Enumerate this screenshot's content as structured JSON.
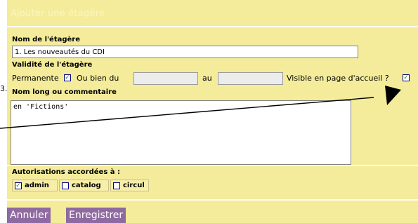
{
  "form": {
    "title": "Ajouter une étagère",
    "name_label": "Nom de l'étagère",
    "name_value": "1. Les nouveautés du CDI",
    "validity_label": "Validité de l'étagère",
    "permanent_label": "Permanente",
    "permanent_checked": true,
    "between_label": "Ou bien du",
    "from_value": "",
    "to_label": "au",
    "to_value": "",
    "visible_label": "Visible en page d'accueil ?",
    "visible_checked": true,
    "comment_label": "Nom long ou commentaire",
    "comment_value": "en 'Fictions'",
    "permissions_label": "Autorisations accordées à :",
    "permissions": [
      {
        "label": "admin",
        "checked": true
      },
      {
        "label": "catalog",
        "checked": false
      },
      {
        "label": "circul",
        "checked": false
      }
    ]
  },
  "buttons": {
    "cancel_label": "Annuler",
    "save_label": "Enregistrer"
  },
  "edge_text": "3.",
  "colors": {
    "panel": "#f4ec9a",
    "button": "#8e6aa0",
    "checkmark": "#2a7a2a"
  },
  "annotation": {
    "type": "arrow",
    "direction": "points to visible-on-homepage checkbox"
  }
}
